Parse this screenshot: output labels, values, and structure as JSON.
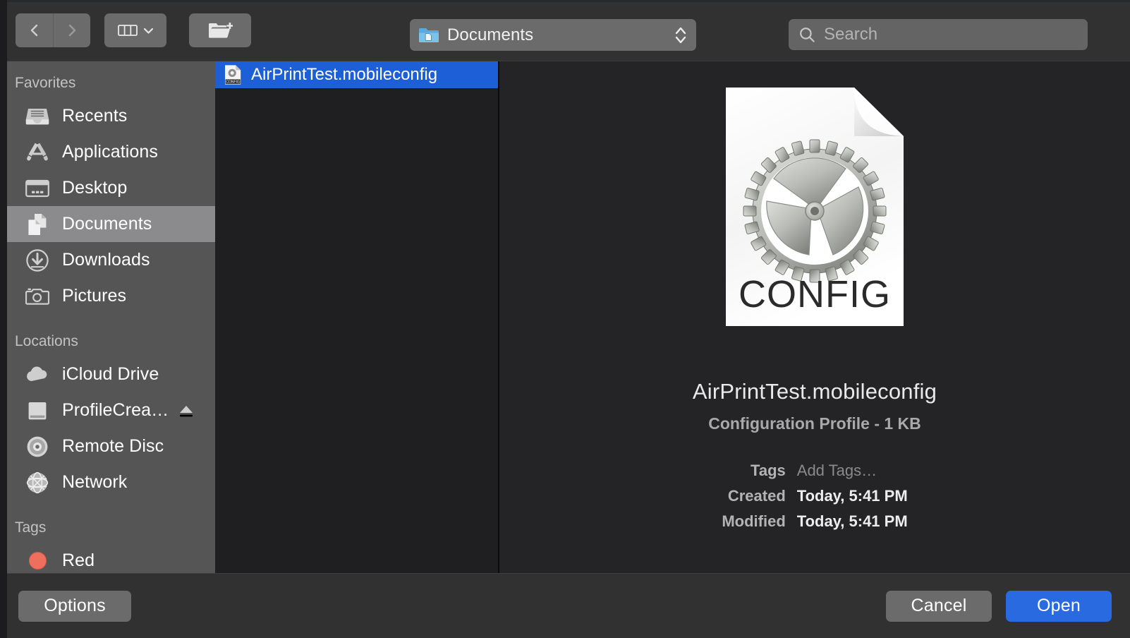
{
  "toolbar": {
    "back_icon": "chevron-left-icon",
    "forward_icon": "chevron-right-icon",
    "view_mode_icon": "column-view-icon",
    "view_mode_chevron": "chevron-down-icon",
    "new_folder_icon": "new-folder-icon",
    "path_popup": {
      "label": "Documents",
      "icon": "documents-folder-icon",
      "stepper_icon": "up-down-stepper-icon"
    },
    "search": {
      "placeholder": "Search",
      "value": "",
      "icon": "search-icon"
    }
  },
  "sidebar": {
    "sections": [
      {
        "title": "Favorites",
        "items": [
          {
            "label": "Recents",
            "icon": "recents-tray-icon",
            "selected": false,
            "ejectable": false
          },
          {
            "label": "Applications",
            "icon": "applications-icon",
            "selected": false,
            "ejectable": false
          },
          {
            "label": "Desktop",
            "icon": "desktop-icon",
            "selected": false,
            "ejectable": false
          },
          {
            "label": "Documents",
            "icon": "documents-icon",
            "selected": true,
            "ejectable": false
          },
          {
            "label": "Downloads",
            "icon": "downloads-icon",
            "selected": false,
            "ejectable": false
          },
          {
            "label": "Pictures",
            "icon": "pictures-camera-icon",
            "selected": false,
            "ejectable": false
          }
        ]
      },
      {
        "title": "Locations",
        "items": [
          {
            "label": "iCloud Drive",
            "icon": "icloud-drive-icon",
            "selected": false,
            "ejectable": false
          },
          {
            "label": "ProfileCrea…",
            "icon": "external-disk-icon",
            "selected": false,
            "ejectable": true
          },
          {
            "label": "Remote Disc",
            "icon": "optical-disc-icon",
            "selected": false,
            "ejectable": false
          },
          {
            "label": "Network",
            "icon": "network-globe-icon",
            "selected": false,
            "ejectable": false
          }
        ]
      },
      {
        "title": "Tags",
        "items": [
          {
            "label": "Red",
            "icon": "tag-dot-icon",
            "selected": false,
            "ejectable": false,
            "color": "#ef6f5f"
          }
        ]
      }
    ]
  },
  "file_list": {
    "rows": [
      {
        "name": "AirPrintTest.mobileconfig",
        "icon": "config-file-icon",
        "selected": true
      }
    ]
  },
  "preview": {
    "icon": "config-file-large-icon",
    "icon_badge_text": "CONFIG",
    "title": "AirPrintTest.mobileconfig",
    "subtitle": "Configuration Profile - 1 KB",
    "metadata": [
      {
        "key": "Tags",
        "value": "Add Tags…",
        "placeholder": true
      },
      {
        "key": "Created",
        "value": "Today, 5:41 PM",
        "placeholder": false
      },
      {
        "key": "Modified",
        "value": "Today, 5:41 PM",
        "placeholder": false
      }
    ]
  },
  "footer": {
    "options_label": "Options",
    "cancel_label": "Cancel",
    "open_label": "Open"
  },
  "colors": {
    "accent_blue": "#2a6ae0",
    "selection_blue": "#1d5fd6",
    "sidebar_bg": "#555556",
    "toolbar_bg": "#323132",
    "list_bg": "#1f1f21",
    "preview_bg": "#242426",
    "tag_red": "#ef6f5f"
  }
}
